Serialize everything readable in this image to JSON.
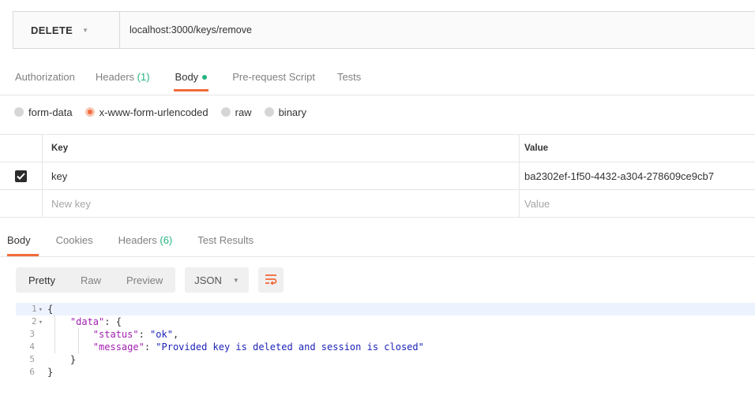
{
  "request": {
    "method": "DELETE",
    "url": "localhost:3000/keys/remove"
  },
  "request_tabs": [
    {
      "label": "Authorization"
    },
    {
      "label": "Headers",
      "count": "(1)"
    },
    {
      "label": "Body",
      "active": true
    },
    {
      "label": "Pre-request Script"
    },
    {
      "label": "Tests"
    }
  ],
  "body_types": [
    {
      "label": "form-data"
    },
    {
      "label": "x-www-form-urlencoded",
      "selected": true
    },
    {
      "label": "raw"
    },
    {
      "label": "binary"
    }
  ],
  "kv_table": {
    "headers": {
      "key": "Key",
      "value": "Value"
    },
    "rows": [
      {
        "key": "key",
        "value": "ba2302ef-1f50-4432-a304-278609ce9cb7",
        "checked": true
      }
    ],
    "new_row": {
      "key": "New key",
      "value": "Value"
    }
  },
  "response_tabs": [
    {
      "label": "Body",
      "active": true
    },
    {
      "label": "Cookies"
    },
    {
      "label": "Headers",
      "count": "(6)"
    },
    {
      "label": "Test Results"
    }
  ],
  "response_view": {
    "modes": [
      "Pretty",
      "Raw",
      "Preview"
    ],
    "active_mode": "Pretty",
    "format": "JSON"
  },
  "code_lines": [
    {
      "n": "1",
      "fold": true,
      "text": "{"
    },
    {
      "n": "2",
      "fold": true,
      "indent": "    ",
      "key": "\"data\"",
      "rest": ": {"
    },
    {
      "n": "3",
      "indent": "        ",
      "key": "\"status\"",
      "sep": ": ",
      "str": "\"ok\"",
      "tail": ","
    },
    {
      "n": "4",
      "indent": "        ",
      "key": "\"message\"",
      "sep": ": ",
      "str": "\"Provided key is deleted and session is closed\"",
      "tail": ""
    },
    {
      "n": "5",
      "text": "    }"
    },
    {
      "n": "6",
      "text": "}"
    }
  ],
  "colors": {
    "accent": "#f26b3a",
    "count_green": "#26b47f",
    "json_key": "#a11fb0",
    "json_string": "#1c23b8"
  }
}
